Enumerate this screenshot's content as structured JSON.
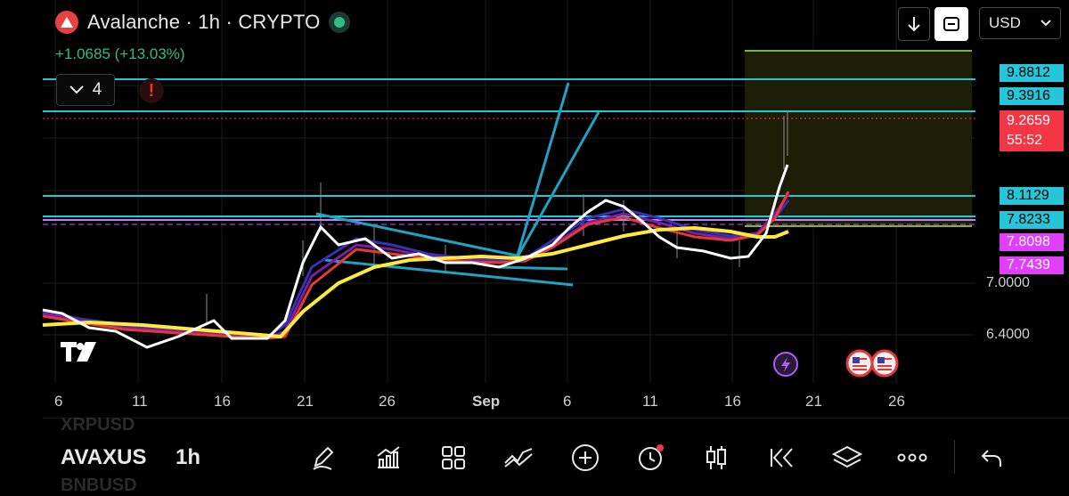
{
  "header": {
    "title": "Avalanche · 1h · CRYPTO",
    "change": "+1.0685 (+13.03%)",
    "indicator_count": "4",
    "alert_mark": "!",
    "currency": "USD"
  },
  "price_labels": [
    {
      "text": "9.8812",
      "bg": "#26c6da",
      "color": "#000000"
    },
    {
      "text": "9.3916",
      "bg": "#26c6da",
      "color": "#000000"
    },
    {
      "text": "9.2659\n55:52",
      "bg": "#f23645",
      "color": "#ffffff"
    },
    {
      "text": "8.1129",
      "bg": "#26c6da",
      "color": "#000000"
    },
    {
      "text": "7.8233",
      "bg": "#26c6da",
      "color": "#000000"
    },
    {
      "text": "7.8098",
      "bg": "#e040fb",
      "color": "#ffffff"
    },
    {
      "text": "7.7439",
      "bg": "#e040fb",
      "color": "#ffffff"
    }
  ],
  "price_axis": [
    "7.0000",
    "6.4000"
  ],
  "date_axis": [
    "6",
    "11",
    "16",
    "21",
    "26",
    "Sep",
    "6",
    "11",
    "16",
    "21",
    "26"
  ],
  "bottom": {
    "symbol_prev": "XRPUSD",
    "symbol": "AVAXUS",
    "symbol_next": "BNBUSD",
    "interval": "1h"
  },
  "toolbar": [
    "pencil-icon",
    "indicators-icon",
    "grid-icon",
    "line-tool-icon",
    "plus-icon",
    "alarm-icon",
    "candle-icon",
    "replay-icon",
    "layers-icon",
    "more-icon",
    "undo-icon"
  ],
  "colors": {
    "accent_green": "#2ebd85",
    "cyan_line": "#26c6da",
    "ema_yellow": "#ffeb3b",
    "ema_white": "#ffffff",
    "ema_red": "#e53935",
    "ema_navy": "#3a2fb5"
  }
}
